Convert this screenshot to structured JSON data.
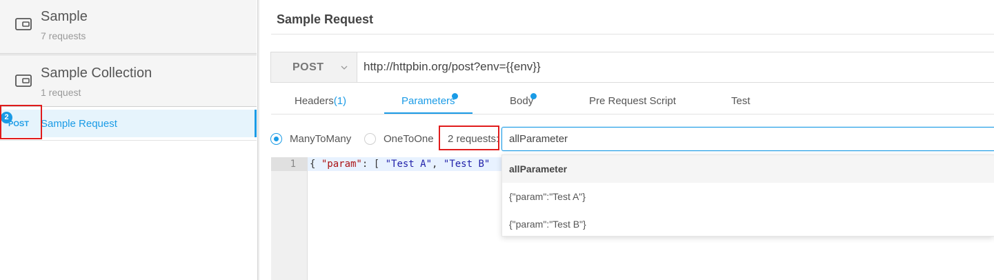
{
  "sidebar": {
    "collections": [
      {
        "name": "Sample",
        "count": "7 requests",
        "icon": "folder-card-icon"
      },
      {
        "name": "Sample Collection",
        "count": "1 request",
        "icon": "folder-card-icon"
      }
    ],
    "request": {
      "badge": "2",
      "method": "POST",
      "name": "Sample Request"
    }
  },
  "main": {
    "title": "Sample Request",
    "method": "POST",
    "url": "http://httpbin.org/post?env={{env}}",
    "tabs": [
      {
        "label": "Headers",
        "count": "(1)"
      },
      {
        "label": "Parameters",
        "active": true,
        "dot": true
      },
      {
        "label": "Body",
        "dot": true
      },
      {
        "label": "Pre Request Script"
      },
      {
        "label": "Test"
      }
    ],
    "modes": [
      {
        "label": "ManyToMany",
        "selected": true
      },
      {
        "label": "OneToOne",
        "selected": false
      }
    ],
    "request_count": "2 requests:",
    "parameter_selected": "allParameter",
    "editor": {
      "line_number": "1",
      "code_parts": [
        "{ ",
        "\"param\"",
        ": [ ",
        "\"Test A\"",
        ", ",
        "\"Test B\""
      ]
    },
    "dropdown_options": [
      "allParameter",
      "{\"param\":\"Test A\"}",
      "{\"param\":\"Test B\"}"
    ]
  },
  "colors": {
    "accent": "#1a9be6",
    "highlight": "#e01b1b"
  }
}
